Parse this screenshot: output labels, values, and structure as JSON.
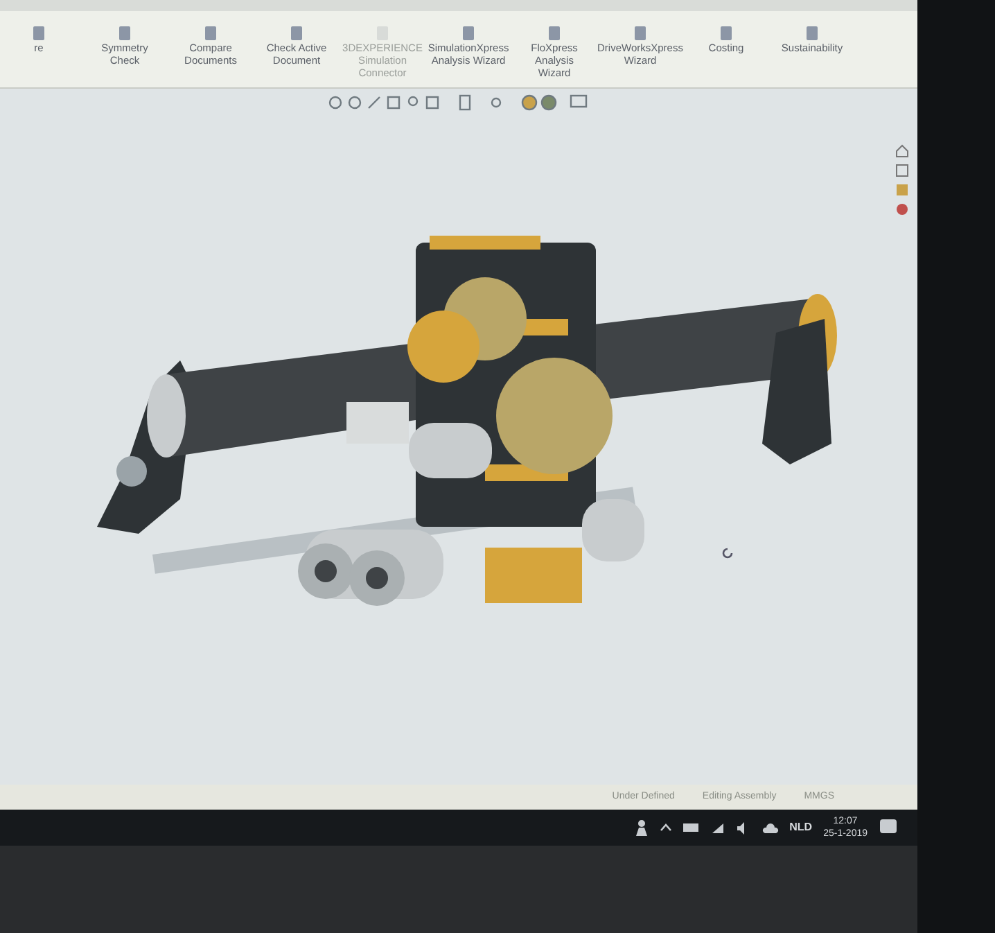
{
  "ribbon": {
    "tools": [
      {
        "label": "re",
        "disabled": false
      },
      {
        "label": "Symmetry Check",
        "disabled": false
      },
      {
        "label": "Compare Documents",
        "disabled": false
      },
      {
        "label": "Check Active Document",
        "disabled": false
      },
      {
        "label": "3DEXPERIENCE Simulation Connector",
        "disabled": true
      },
      {
        "label": "SimulationXpress Analysis Wizard",
        "disabled": false
      },
      {
        "label": "FloXpress Analysis Wizard",
        "disabled": false
      },
      {
        "label": "DriveWorksXpress Wizard",
        "disabled": false
      },
      {
        "label": "Costing",
        "disabled": false
      },
      {
        "label": "Sustainability",
        "disabled": false
      }
    ]
  },
  "status_bar": {
    "items": [
      "Under Defined",
      "Editing Assembly",
      "MMGS"
    ]
  },
  "taskbar": {
    "language": "NLD",
    "time": "12:07",
    "date": "25-1-2019"
  }
}
